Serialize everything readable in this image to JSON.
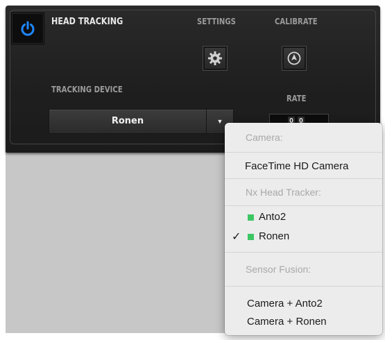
{
  "panel": {
    "title": "HEAD TRACKING",
    "settings_label": "SETTINGS",
    "calibrate_label": "CALIBRATE",
    "tracking_device_label": "TRACKING DEVICE",
    "rate_label": "RATE",
    "selected_device": "Ronen",
    "rate_value": [
      "0",
      "0"
    ],
    "accent_color": "#1e88ff"
  },
  "menu": {
    "camera_header": "Camera:",
    "camera_items": [
      "FaceTime HD Camera"
    ],
    "nx_header": "Nx Head Tracker:",
    "nx_items": [
      {
        "label": "Anto2",
        "status_color": "#3cc764",
        "checked": false
      },
      {
        "label": "Ronen",
        "status_color": "#3cc764",
        "checked": true
      }
    ],
    "check_mark": "✓",
    "fusion_header": "Sensor Fusion:",
    "fusion_items": [
      "Camera + Anto2",
      "Camera + Ronen"
    ]
  }
}
